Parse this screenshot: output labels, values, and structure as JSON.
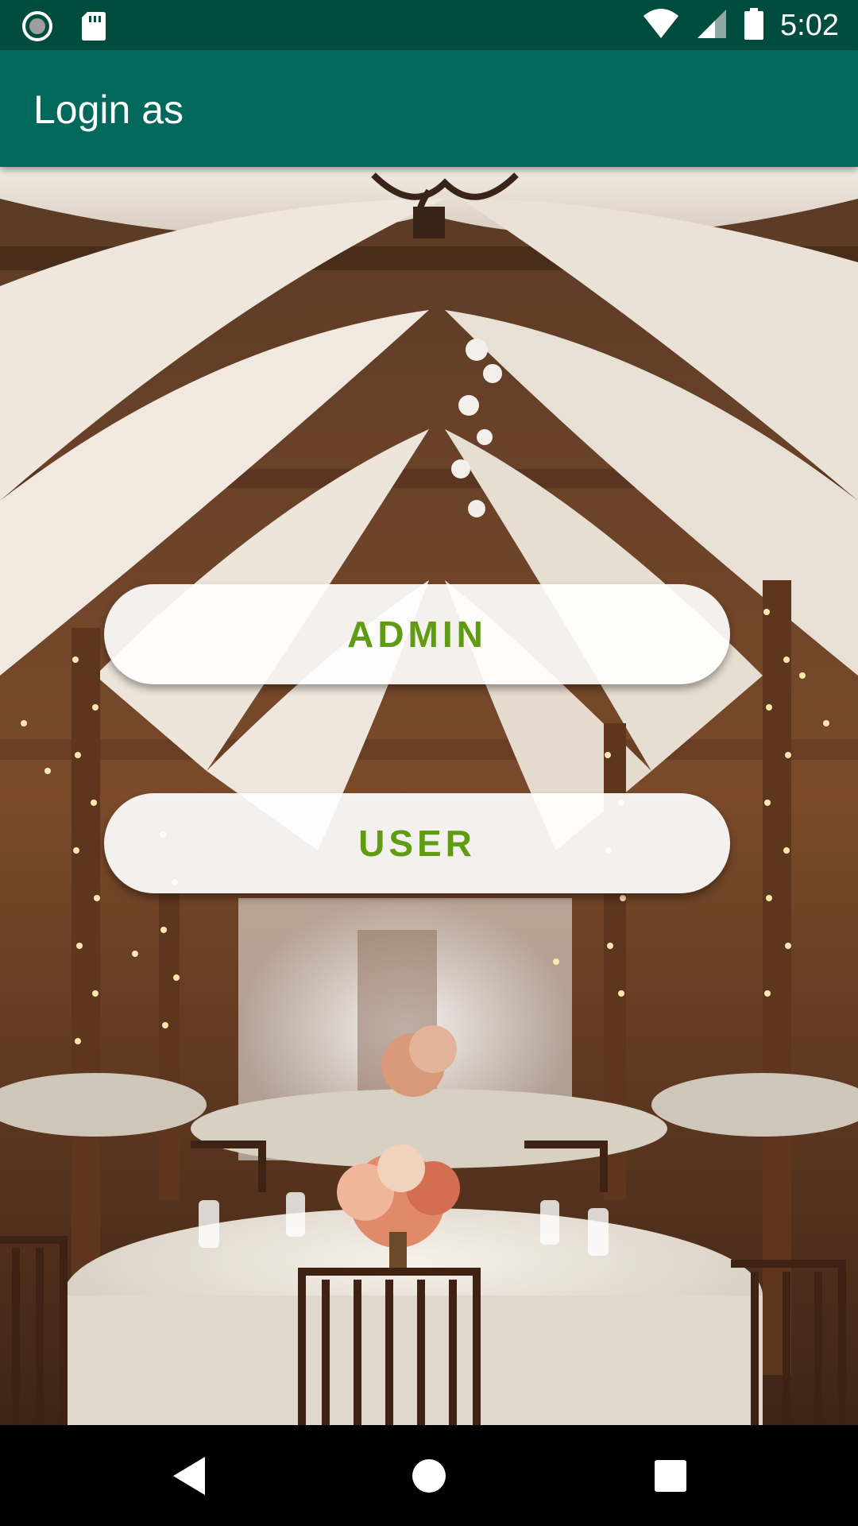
{
  "status_bar": {
    "time": "5:02",
    "icons": [
      "record-icon",
      "sd-card-icon",
      "wifi-icon",
      "signal-icon",
      "battery-icon"
    ]
  },
  "app_bar": {
    "title": "Login as"
  },
  "buttons": {
    "admin_label": "ADMIN",
    "user_label": "USER"
  },
  "nav_bar": {
    "icons": [
      "back-icon",
      "home-icon",
      "recents-icon"
    ]
  },
  "colors": {
    "status_bar": "#004d40",
    "app_bar": "#00695c",
    "button_text": "#5f9c12",
    "button_bg": "#ffffff"
  },
  "background_image": "wedding banquet hall with draped ceiling fabric, string lights and round dining tables"
}
